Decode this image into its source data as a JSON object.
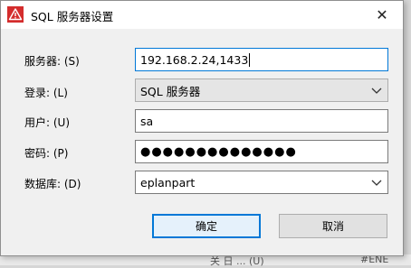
{
  "dialog": {
    "title": "SQL 服务器设置",
    "close_glyph": "✕"
  },
  "form": {
    "server_label": "服务器: (S)",
    "server_value": "192.168.2.24,1433",
    "login_label": "登录: (L)",
    "login_value": "SQL 服务器",
    "user_label": "用户: (U)",
    "user_value": "sa",
    "password_label": "密码: (P)",
    "password_value": "●●●●●●●●●●●●●●",
    "database_label": "数据库: (D)",
    "database_value": "eplanpart"
  },
  "buttons": {
    "ok": "确定",
    "cancel": "取消"
  },
  "background": {
    "fragment1": "关 日 ... (U)",
    "fragment2": "#ENE"
  },
  "icons": {
    "app": "warning-triangle-icon",
    "close": "close-icon",
    "dropdown": "chevron-down-icon"
  },
  "colors": {
    "accent": "#0078d7",
    "icon_red": "#d42d2d"
  }
}
